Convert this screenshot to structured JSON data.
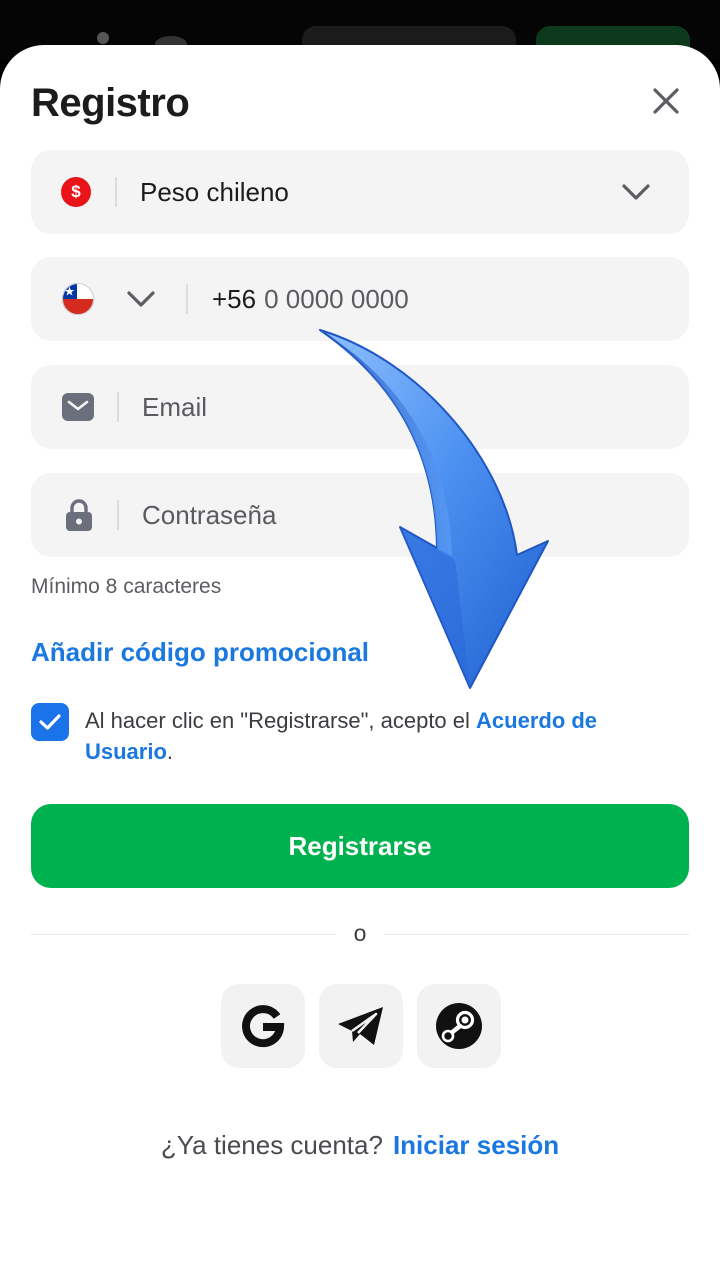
{
  "header": {
    "title": "Registro"
  },
  "currency": {
    "symbol": "$",
    "value": "Peso chileno"
  },
  "phone": {
    "code": "+56",
    "placeholder": "0 0000 0000"
  },
  "email": {
    "placeholder": "Email"
  },
  "password": {
    "placeholder": "Contraseña",
    "hint": "Mínimo 8 caracteres"
  },
  "promo": {
    "label": "Añadir código promocional"
  },
  "terms": {
    "checked": true,
    "text": "Al hacer clic en \"Registrarse\", acepto el ",
    "link": "Acuerdo de Usuario",
    "suffix": "."
  },
  "submit": {
    "label": "Registrarse"
  },
  "divider": {
    "label": "o"
  },
  "social": [
    "google-icon",
    "telegram-icon",
    "steam-icon"
  ],
  "footer": {
    "question": "¿Ya tienes cuenta?",
    "login_label": "Iniciar sesión"
  },
  "colors": {
    "accent": "#1a78e0",
    "primary_button": "#00b14f",
    "field_bg": "#f4f4f5",
    "arrow": "#3f82ea"
  }
}
